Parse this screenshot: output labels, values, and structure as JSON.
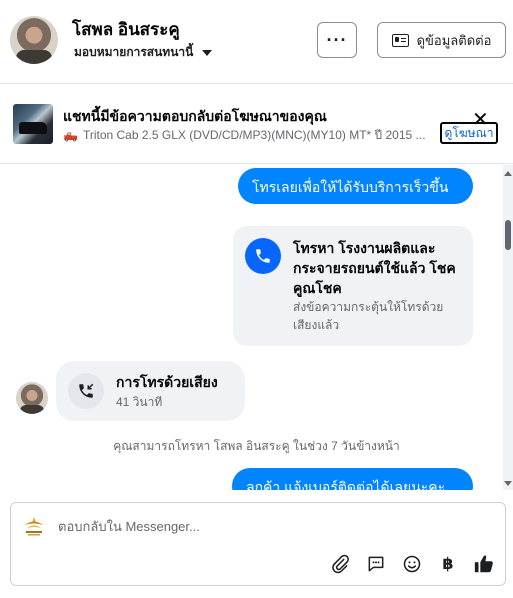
{
  "header": {
    "contact_name": "โสพล อินสระคู",
    "assign_label": "มอบหมายการสนทนานี้",
    "more_label": "···",
    "contact_info_label": "ดูข้อมูลติดต่อ"
  },
  "ad": {
    "title": "แชทนี้มีข้อความตอบกลับต่อโฆษณาของคุณ",
    "subtitle": "Triton Cab 2.5 GLX (DVD/CD/MP3)(MNC)(MY10) MT* ปี 2015 ...",
    "view_ad_label": "ดูโฆษณา",
    "close_label": "✕"
  },
  "messages": {
    "outgoing_1": "โทรเลยเพื่อให้ได้รับบริการเร็วขึ้น",
    "call_card_title": "โทรหา โรงงานผลิตและกระจายรถยนต์ใช้แล้ว โชคคูณโชค",
    "call_card_desc": "ส่งข้อความกระตุ้นให้โทรด้วยเสียงแล้ว",
    "voice_call_title": "การโทรด้วยเสียง",
    "voice_call_duration": "41 วินาที",
    "system_note": "คุณสามารถโทรหา โสพล อินสระคู ในช่วง 7 วันข้างหน้า",
    "outgoing_2": "ลูกค้า แจ้งเบอร์ติดต่อได้เลยนะคะ"
  },
  "composer": {
    "placeholder": "ตอบกลับใน Messenger...",
    "icons": [
      "attachment-icon",
      "saved-reply-icon",
      "emoji-icon",
      "baht-icon",
      "like-icon"
    ]
  },
  "colors": {
    "accent": "#0084ff",
    "call_blue": "#0866ff",
    "bubble_gray": "#f0f2f5",
    "muted_text": "#65676b"
  }
}
